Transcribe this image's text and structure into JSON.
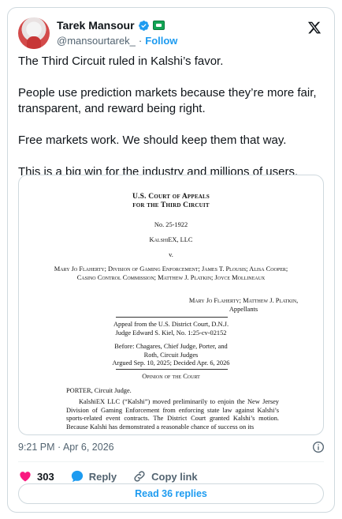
{
  "author": {
    "display_name": "Tarek Mansour",
    "handle": "@mansourtarek_",
    "separator": "·",
    "follow_label": "Follow"
  },
  "tweet": {
    "paragraphs": [
      "The Third Circuit ruled in Kalshi’s favor.",
      "People use prediction markets because they’re more fair, transparent, and reward being right.",
      "Free markets work. We should keep them that way.",
      "This is a big win for the industry and millions of users."
    ]
  },
  "document": {
    "court_line1": "U.S. Court of Appeals",
    "court_line2": "for the Third Circuit",
    "case_no": "No. 25-1922",
    "appellee": "KalshiEX, LLC",
    "versus": "v.",
    "appellants_list": "Mary Jo Flaherty; Division of Gaming Enforcement; James T. Plousis; Alisa Cooper; Casino Control Commission; Matthew J. Platkin; Joyce Mollineaux",
    "appellants_named": "Mary Jo Flaherty; Matthew J. Platkin,",
    "appellants_label": "Appellants",
    "appeal_from": "Appeal from the U.S. District Court, D.N.J.",
    "judge_line": "Judge Edward S. Kiel, No. 1:25-cv-02152",
    "before_line1": "Before: Chagares, Chief Judge, Porter, and",
    "before_line2": "Roth, Circuit Judges",
    "argued": "Argued Sep. 10, 2025; Decided Apr. 6, 2026",
    "opinion_heading": "Opinion of the Court",
    "author_line": "PORTER, Circuit Judge.",
    "body": "KalshiEX LLC (“Kalshi”) moved preliminarily to enjoin the New Jersey Division of Gaming Enforcement from enforcing state law against Kalshi’s sports-related event contracts. The District Court granted Kalshi’s motion. Because Kalshi has demonstrated a reasonable chance of success on its"
  },
  "meta": {
    "timestamp": "9:21 PM · Apr 6, 2026"
  },
  "actions": {
    "like_count": "303",
    "reply_label": "Reply",
    "copy_link_label": "Copy link"
  },
  "read_replies_label": "Read 36 replies",
  "colors": {
    "accent": "#1d9bf0",
    "like": "#f91880",
    "text": "#0f1419",
    "muted": "#536471",
    "border": "#cfd9de"
  },
  "icons": [
    "verified-badge-icon",
    "affiliate-badge-icon",
    "x-logo-icon",
    "info-icon",
    "heart-icon",
    "reply-bubble-icon",
    "link-icon"
  ]
}
